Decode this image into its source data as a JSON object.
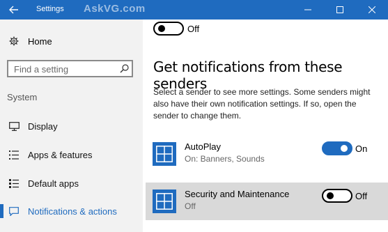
{
  "window": {
    "title": "Settings",
    "watermark": "AskVG.com"
  },
  "sidebar": {
    "home_label": "Home",
    "search_placeholder": "Find a setting",
    "section_label": "System",
    "items": [
      {
        "label": "Display",
        "icon": "display-icon"
      },
      {
        "label": "Apps & features",
        "icon": "apps-list-icon"
      },
      {
        "label": "Default apps",
        "icon": "default-apps-icon"
      },
      {
        "label": "Notifications & actions",
        "icon": "message-icon",
        "active": true
      }
    ]
  },
  "main": {
    "top_toggle_state": "Off",
    "heading": "Get notifications from these senders",
    "description": "Select a sender to see more settings. Some senders might also have their own notification settings. If so, open the sender to change them.",
    "senders": [
      {
        "name": "AutoPlay",
        "subtitle": "On: Banners, Sounds",
        "toggle": "On"
      },
      {
        "name": "Security and Maintenance",
        "subtitle": "Off",
        "toggle": "Off"
      }
    ]
  },
  "colors": {
    "accent": "#1f6bbf",
    "sidebar_bg": "#f2f2f2",
    "highlight_row": "#d9d9d9"
  }
}
